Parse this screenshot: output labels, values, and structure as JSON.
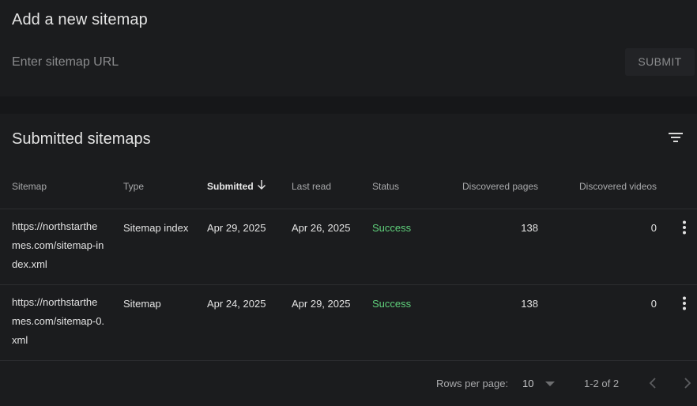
{
  "add_section": {
    "title": "Add a new sitemap",
    "input_placeholder": "Enter sitemap URL",
    "submit_label": "SUBMIT"
  },
  "submitted_section": {
    "title": "Submitted sitemaps",
    "filter_icon": "filter-icon"
  },
  "table": {
    "headers": {
      "sitemap": "Sitemap",
      "type": "Type",
      "submitted": "Submitted",
      "last_read": "Last read",
      "status": "Status",
      "discovered_pages": "Discovered pages",
      "discovered_videos": "Discovered videos"
    },
    "sort": {
      "column": "Submitted",
      "direction": "descending",
      "icon": "arrow-down-icon"
    },
    "rows": [
      {
        "sitemap": "https://northstarthemes.com/sitemap-index.xml",
        "type": "Sitemap index",
        "submitted": "Apr 29, 2025",
        "last_read": "Apr 26, 2025",
        "status": "Success",
        "discovered_pages": "138",
        "discovered_videos": "0"
      },
      {
        "sitemap": "https://northstarthemes.com/sitemap-0.xml",
        "type": "Sitemap",
        "submitted": "Apr 24, 2025",
        "last_read": "Apr 29, 2025",
        "status": "Success",
        "discovered_pages": "138",
        "discovered_videos": "0"
      }
    ]
  },
  "pagination": {
    "rows_per_page_label": "Rows per page:",
    "rows_per_page_value": "10",
    "range": "1-2 of 2"
  },
  "colors": {
    "background": "#1b1c1e",
    "separator_band": "#161719",
    "success": "#5fd07b",
    "text_primary": "#e3e3e3",
    "text_secondary": "#a8a9ab"
  }
}
